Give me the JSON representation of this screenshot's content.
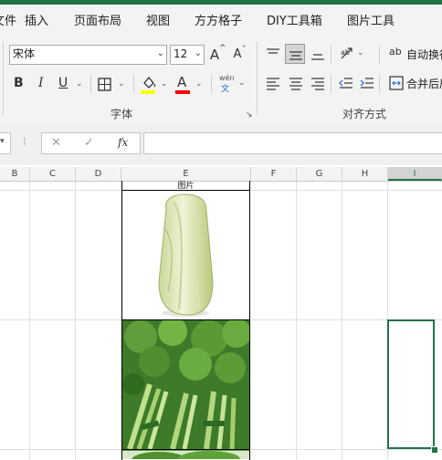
{
  "ribbon_tabs": [
    {
      "label": "文件"
    },
    {
      "label": "插入"
    },
    {
      "label": "页面布局"
    },
    {
      "label": "视图"
    },
    {
      "label": "方方格子"
    },
    {
      "label": "DIY工具箱"
    },
    {
      "label": "图片工具"
    }
  ],
  "font_group": {
    "font_name": "宋体",
    "font_size": "12",
    "grow_label": "A",
    "shrink_label": "A",
    "bold_label": "B",
    "italic_label": "I",
    "underline_label": "U",
    "phonetic_top": "wén",
    "phonetic_bottom": "文",
    "group_label": "字体",
    "fill_color": "#ffff00",
    "font_color": "#ff0000"
  },
  "align_group": {
    "wrap_text_label": "自动换行",
    "merge_label": "合并后居中",
    "group_label": "对齐方式"
  },
  "formula_bar": {
    "cancel_glyph": "✕",
    "enter_glyph": "✓",
    "fx_label": "fx",
    "formula": ""
  },
  "columns": [
    "B",
    "C",
    "D",
    "E",
    "F",
    "G",
    "H",
    "I"
  ],
  "cells": {
    "e_header": "图片"
  },
  "images": [
    "napa-cabbage-image",
    "celery-image",
    "leafy-vegetable-image"
  ],
  "theme": {
    "accent": "#217346",
    "ribbon_bg": "#f3f3f3",
    "grid_line": "#e0e0e0"
  }
}
